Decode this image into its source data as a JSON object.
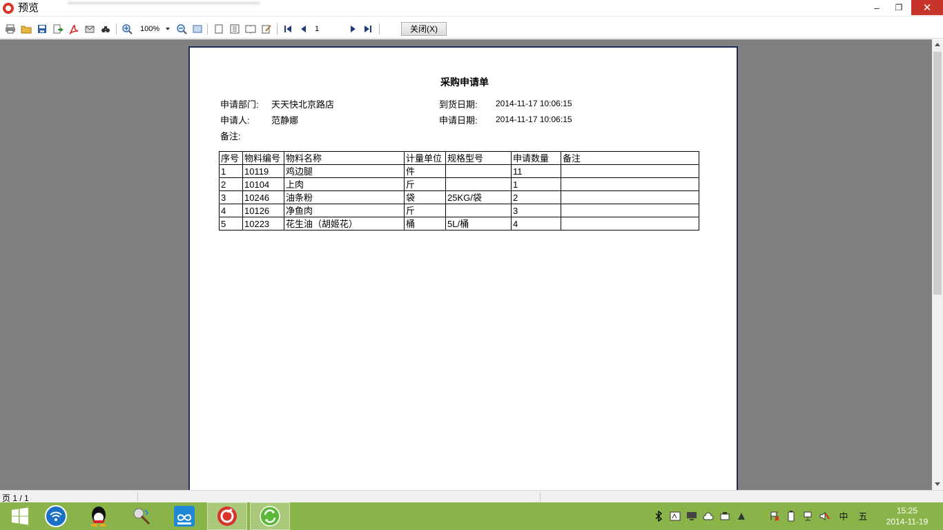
{
  "window": {
    "title": "预览",
    "minimize": "–",
    "restore": "❐",
    "close": "✕"
  },
  "toolbar": {
    "zoom": "100%",
    "page_input": "1",
    "close_label": "关闭(X)"
  },
  "document": {
    "title": "采购申请单",
    "dept_label": "申请部门:",
    "dept_value": "天天快北京路店",
    "arrival_label": "到货日期:",
    "arrival_value": "2014-11-17 10:06:15",
    "applicant_label": "申请人:",
    "applicant_value": "范静娜",
    "apply_date_label": "申请日期:",
    "apply_date_value": "2014-11-17 10:06:15",
    "remark_label": "备注:",
    "table": {
      "headers": [
        "序号",
        "物料编号",
        "物料名称",
        "计量单位",
        "规格型号",
        "申请数量",
        "备注"
      ],
      "rows": [
        [
          "1",
          "10119",
          "鸡边腿",
          "件",
          "",
          "11",
          ""
        ],
        [
          "2",
          "10104",
          "上肉",
          "斤",
          "",
          "1",
          ""
        ],
        [
          "3",
          "10246",
          "油条粉",
          "袋",
          "25KG/袋",
          "2",
          ""
        ],
        [
          "4",
          "10126",
          "净鱼肉",
          "斤",
          "",
          "3",
          ""
        ],
        [
          "5",
          "10223",
          "花生油（胡姬花）",
          "桶",
          "5L/桶",
          "4",
          ""
        ]
      ]
    }
  },
  "statusbar": {
    "page": "页 1 / 1"
  },
  "taskbar": {
    "tray_ime1": "中",
    "tray_ime2": "五",
    "time": "15:25",
    "date": "2014-11-19"
  }
}
